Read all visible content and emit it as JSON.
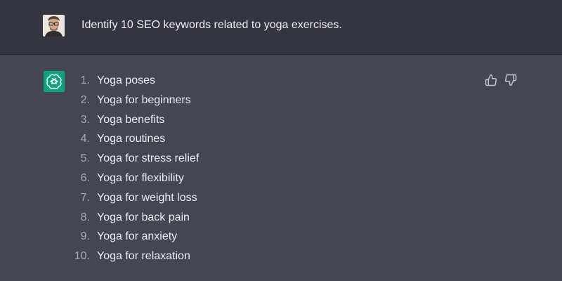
{
  "conversation": {
    "user": {
      "avatar_icon": "user-photo-avatar",
      "message": "Identify 10 SEO keywords related to yoga exercises."
    },
    "assistant": {
      "avatar_icon": "openai-logo-icon",
      "avatar_color": "#10a37f",
      "list": [
        {
          "number": "1.",
          "text": "Yoga poses"
        },
        {
          "number": "2.",
          "text": "Yoga for beginners"
        },
        {
          "number": "3.",
          "text": "Yoga benefits"
        },
        {
          "number": "4.",
          "text": "Yoga routines"
        },
        {
          "number": "5.",
          "text": "Yoga for stress relief"
        },
        {
          "number": "6.",
          "text": "Yoga for flexibility"
        },
        {
          "number": "7.",
          "text": "Yoga for weight loss"
        },
        {
          "number": "8.",
          "text": "Yoga for back pain"
        },
        {
          "number": "9.",
          "text": "Yoga for anxiety"
        },
        {
          "number": "10.",
          "text": "Yoga for relaxation"
        }
      ],
      "feedback_icons": [
        "thumbs-up-icon",
        "thumbs-down-icon"
      ]
    }
  },
  "colors": {
    "user_row_bg": "#343541",
    "assistant_row_bg": "#444654",
    "text": "#ececf1",
    "accent": "#10a37f"
  }
}
